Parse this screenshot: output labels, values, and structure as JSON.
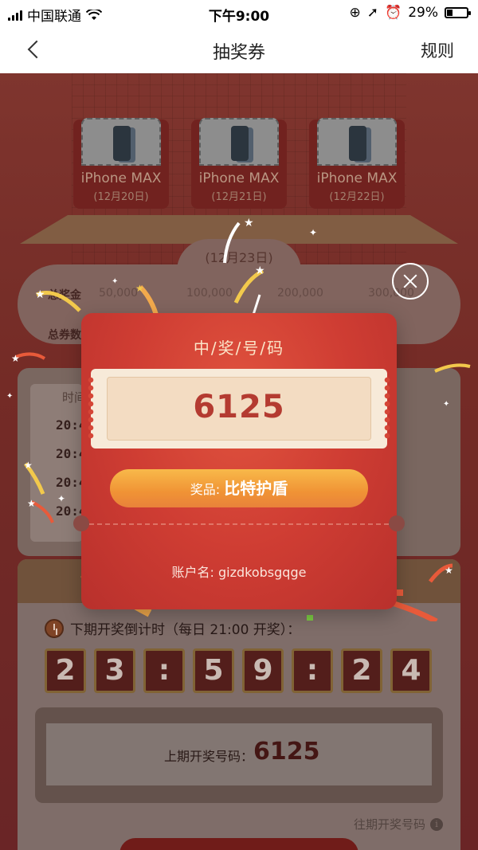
{
  "status_bar": {
    "carrier": "中国联通",
    "time": "下午9:00",
    "battery": "29%",
    "battery_level": 0.29
  },
  "nav": {
    "title": "抽奖券",
    "rules": "规则"
  },
  "background": {
    "prizes": [
      {
        "name": "iPhone MAX",
        "date": "(12月20日)"
      },
      {
        "name": "iPhone MAX",
        "date": "(12月21日)"
      },
      {
        "name": "iPhone MAX",
        "date": "(12月22日)"
      }
    ],
    "stats": {
      "date_tab": "(12月23日)",
      "prize_pool_label": "总奖金",
      "total_tickets_label": "总券数",
      "ticks": [
        "50,000",
        "100,000",
        "200,000",
        "300,000"
      ]
    },
    "records": {
      "header": "时间",
      "times": [
        "20:4",
        "20:4",
        "20:4",
        "20:4"
      ]
    },
    "countdown": {
      "label": "下期开奖倒计时（每日 21:00 开奖）：",
      "digits": [
        "2",
        "3",
        ":",
        "5",
        "9",
        ":",
        "2",
        "4"
      ]
    },
    "last_draw": {
      "label": "上期开奖号码：",
      "value": "6125"
    },
    "history_link": "往期开奖号码",
    "info_icon_glyph": "i"
  },
  "modal": {
    "title": "中/奖/号/码",
    "number": "6125",
    "prize_label": "奖品: ",
    "prize_value": "比特护盾",
    "account": "账户名: gizdkobsgqge"
  },
  "colors": {
    "modal_red": "#cf3d33",
    "ticket_number": "#b43b31",
    "prize_btn": "#f09335"
  }
}
